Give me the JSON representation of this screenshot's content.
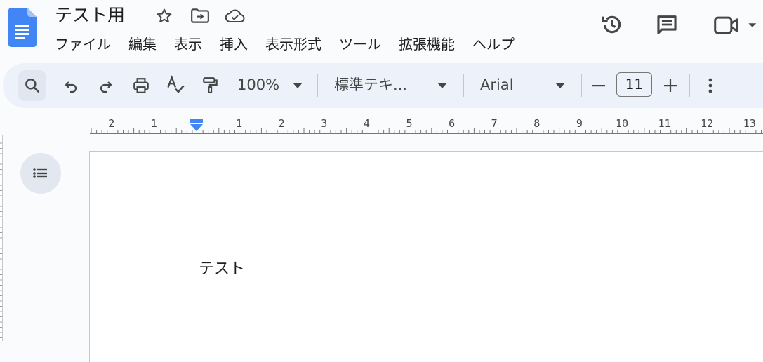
{
  "document": {
    "title": "テスト用",
    "body_text": "テスト"
  },
  "menu": [
    {
      "label": "ファイル",
      "name": "menu-file"
    },
    {
      "label": "編集",
      "name": "menu-edit"
    },
    {
      "label": "表示",
      "name": "menu-view"
    },
    {
      "label": "挿入",
      "name": "menu-insert"
    },
    {
      "label": "表示形式",
      "name": "menu-format"
    },
    {
      "label": "ツール",
      "name": "menu-tools"
    },
    {
      "label": "拡張機能",
      "name": "menu-extensions"
    },
    {
      "label": "ヘルプ",
      "name": "menu-help"
    }
  ],
  "toolbar": {
    "zoom": "100%",
    "paragraph_style": "標準テキ...",
    "font_family": "Arial",
    "font_size": "11"
  },
  "ruler": {
    "labels": [
      "2",
      "1",
      "1",
      "2",
      "3",
      "4",
      "5",
      "6",
      "7",
      "8",
      "9",
      "10",
      "11",
      "12",
      "13"
    ]
  },
  "icons": {
    "header": [
      "docs-logo-icon",
      "star-icon",
      "move-to-folder-icon",
      "cloud-saved-icon"
    ],
    "right": [
      "version-history-icon",
      "comment-icon",
      "meet-video-icon"
    ],
    "toolbar": [
      "search-icon",
      "undo-icon",
      "redo-icon",
      "print-icon",
      "spellcheck-icon",
      "paint-format-icon",
      "more-options-icon"
    ]
  },
  "colors": {
    "brand_blue": "#4285f4",
    "toolbar_bg": "#edf2fa",
    "page_bg": "#f9fbfd",
    "indent_marker": "#4285f4"
  }
}
